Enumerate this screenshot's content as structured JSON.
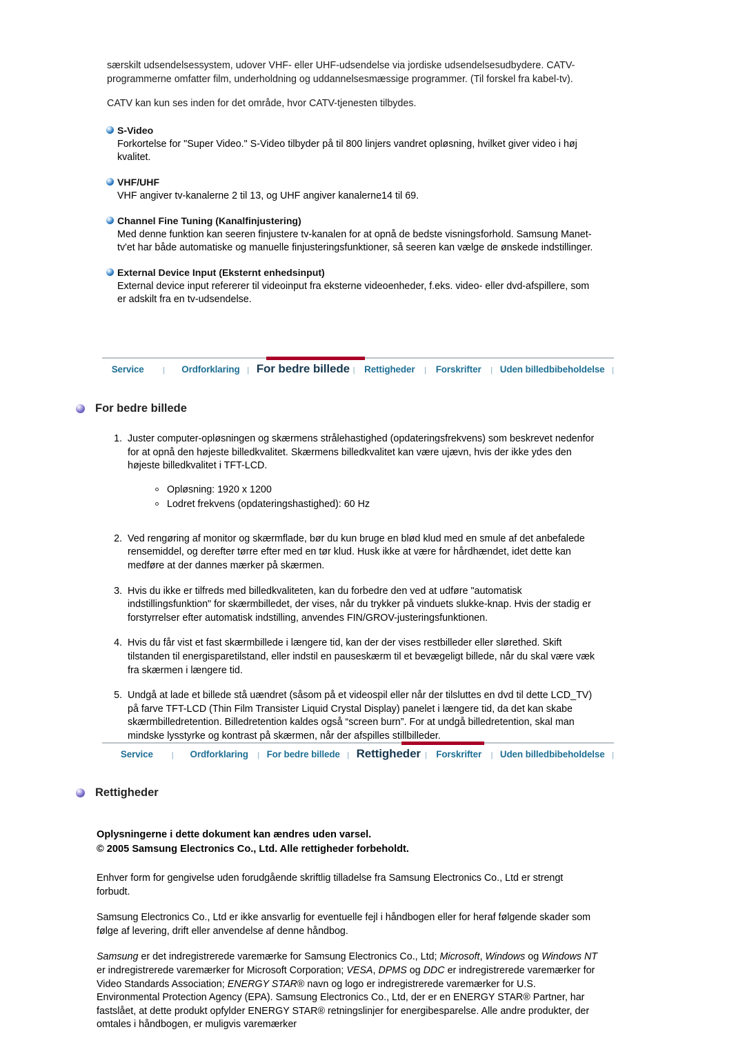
{
  "glossary": {
    "intro_paragraph": "særskilt udsendelsessystem, udover VHF- eller UHF-udsendelse via jordiske udsendelsesudbydere. CATV-programmerne omfatter film, underholdning og uddannelsesmæssige programmer.   (Til forskel fra kabel-tv).",
    "second_paragraph": "CATV kan kun ses inden for det område, hvor CATV-tjenesten tilbydes.",
    "terms": [
      {
        "title": "S-Video",
        "body": "Forkortelse for \"Super Video.\"   S-Video tilbyder på til 800 linjers vandret opløsning, hvilket giver video i høj kvalitet."
      },
      {
        "title": "VHF/UHF",
        "body": "VHF angiver tv-kanalerne 2 til 13, og UHF angiver kanalerne14 til 69."
      },
      {
        "title": "Channel Fine Tuning (Kanalfinjustering)",
        "body": "Med denne funktion kan seeren finjustere tv-kanalen for at opnå de bedste visningsforhold.   Samsung Manet-tv'et har både automatiske og manuelle finjusteringsfunktioner, så seeren kan vælge de ønskede indstillinger."
      },
      {
        "title": "External Device Input (Eksternt enhedsinput)",
        "body": "External device input refererer til videoinput fra eksterne videoenheder, f.eks. video- eller dvd-afspillere, som er adskilt fra en tv-udsendelse."
      }
    ]
  },
  "navbar_top": {
    "active": "For bedre billede",
    "tabs": [
      "Service",
      "Ordforklaring",
      "For bedre billede",
      "Rettigheder",
      "Forskrifter",
      "Uden billedbibeholdelse"
    ],
    "separator": "|",
    "active_bar_color": "#a90026",
    "inactive_color": "#1d6f94",
    "active_color": "#17384f"
  },
  "navbar_bottom": {
    "active": "Rettigheder",
    "tabs": [
      "Service",
      "Ordforklaring",
      "For bedre billede",
      "Rettigheder",
      "Forskrifter",
      "Uden billedbibeholdelse"
    ],
    "separator": "|",
    "active_bar_color": "#a90026",
    "inactive_color": "#1d6f94",
    "active_color": "#17384f"
  },
  "section_picture": {
    "heading": "For bedre billede",
    "items": [
      {
        "num": "1.",
        "text": "Juster computer-opløsningen og skærmens strålehastighed (opdateringsfrekvens) som beskrevet nedenfor for at opnå den højeste billedkvalitet. Skærmens billedkvalitet kan være ujævn, hvis der ikke ydes den højeste billedkvalitet i TFT-LCD.",
        "sub": [
          "Opløsning: 1920 x 1200",
          "Lodret frekvens (opdateringshastighed): 60 Hz"
        ]
      },
      {
        "num": "2.",
        "text": "Ved rengøring af monitor og skærmflade, bør du kun bruge en blød klud med en smule af det anbefalede rensemiddel, og derefter tørre efter med en tør klud. Husk ikke at være for hårdhændet, idet dette kan medføre at der dannes mærker på skærmen."
      },
      {
        "num": "3.",
        "text": "Hvis du ikke er tilfreds med billedkvaliteten, kan du forbedre den ved at udføre \"automatisk indstillingsfunktion\" for skærmbilledet, der vises, når du trykker på vinduets slukke-knap. Hvis der stadig er forstyrrelser efter automatisk indstilling, anvendes FIN/GROV-justeringsfunktionen."
      },
      {
        "num": "4.",
        "text": "Hvis du får vist et fast skærmbillede i længere tid, kan der der vises restbilleder eller slørethed. Skift tilstanden til energisparetilstand, eller indstil en pauseskærm til et bevægeligt billede, når du skal være væk fra skærmen i længere tid."
      },
      {
        "num": "5.",
        "text": "Undgå at lade et billede stå uændret (såsom på et videospil eller når der tilsluttes en dvd til dette LCD_TV) på farve TFT-LCD (Thin Film Transister Liquid Crystal Display) panelet i længere tid, da det kan skabe skærmbilledretention. Billedretention kaldes også “screen burn”. For at undgå billedretention, skal man mindske lysstyrke og kontrast på skærmen, når der afspilles stillbilleder."
      }
    ]
  },
  "section_rights": {
    "heading": "Rettigheder",
    "bold_line_1": "Oplysningerne i dette dokument kan ændres uden varsel.",
    "bold_line_2": "© 2005 Samsung Electronics Co., Ltd. Alle rettigheder forbeholdt.",
    "paragraph_1": "Enhver form for gengivelse uden forudgående skriftlig tilladelse fra Samsung Electronics Co., Ltd er strengt forbudt.",
    "paragraph_2": "Samsung Electronics Co., Ltd er ikke ansvarlig for eventuelle fejl i håndbogen eller for heraf følgende skader som følge af levering, drift eller anvendelse af denne håndbog.",
    "trademark_parts": {
      "p1": " er det indregistrerede varemærke for Samsung Electronics Co., Ltd; ",
      "i1": "Samsung",
      "i2": "Microsoft",
      "c1": ", ",
      "i3": "Windows",
      "p2": " og ",
      "i4": "Windows NT",
      "p3": " er indregistrerede varemærker for Microsoft Corporation;  ",
      "i5": "VESA",
      "c2": ", ",
      "i6": "DPMS",
      "p4": " og ",
      "i7": "DDC",
      "p5": " er indregistrerede varemærker for Video Standards Association; ",
      "i8": "ENERGY STAR",
      "p6": "® navn og logo er indregistrerede varemærker for U.S. Environmental Protection Agency (EPA). Samsung Electronics Co., Ltd, der er en ENERGY STAR® Partner, har fastslået, at dette produkt opfylder ENERGY STAR® retningslinjer for energibesparelse. Alle andre produkter, der omtales i håndbogen, er muligvis varemærker"
    }
  }
}
